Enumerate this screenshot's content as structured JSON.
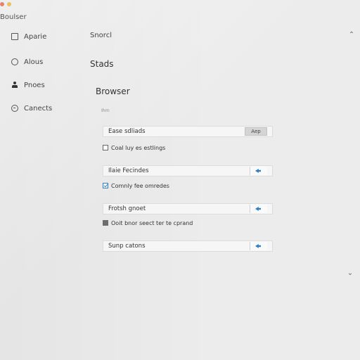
{
  "window": {
    "title": "Boulser"
  },
  "sidebar": {
    "items": [
      {
        "label": "Aparie",
        "icon": "document-icon"
      },
      {
        "label": "Alous",
        "icon": "circle-icon"
      },
      {
        "label": "Pnoes",
        "icon": "person-icon"
      },
      {
        "label": "Canects",
        "icon": "ring-icon"
      }
    ]
  },
  "header": {
    "search_label": "Snorcl"
  },
  "main": {
    "heading": "Stads",
    "section_title": "Browser",
    "section_subtitle": "Ihrn",
    "rows": [
      {
        "label": "Ease sdliads",
        "control": "button",
        "button_label": "Aep"
      },
      {
        "label": "Ilaie Fecindes",
        "control": "toggle"
      },
      {
        "label": "Frotsh gnoet",
        "control": "toggle"
      },
      {
        "label": "Sunp catons",
        "control": "toggle"
      }
    ],
    "checkboxes": [
      {
        "label": "Coal luy es estlings",
        "state": "unchecked"
      },
      {
        "label": "Comnly fee omredes",
        "state": "checked"
      },
      {
        "label": "Ooit bnor seect ter te cprand",
        "state": "filled"
      }
    ]
  },
  "colors": {
    "accent": "#2f7fc8",
    "background": "#ececec",
    "close": "#e4826e",
    "minimize": "#e9c15a"
  }
}
